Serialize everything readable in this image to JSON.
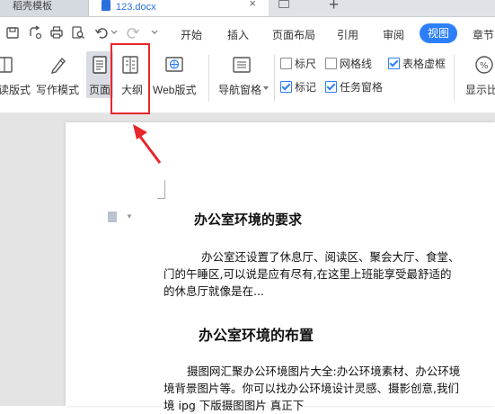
{
  "tabs": {
    "template_tab": "稻壳模板",
    "doc_tab": "123.docx",
    "close_glyph": "×",
    "new_tab_glyph": "+"
  },
  "menu": {
    "items": [
      "开始",
      "插入",
      "页面布局",
      "引用",
      "审阅"
    ],
    "active": "视图",
    "overflow": "章节"
  },
  "ribbon": {
    "views": [
      "读版式",
      "写作模式",
      "页面",
      "大纲",
      "Web版式"
    ],
    "nav_pane": "导航窗格",
    "checkboxes": [
      {
        "label": "标尺",
        "checked": false
      },
      {
        "label": "网格线",
        "checked": false
      },
      {
        "label": "表格虚框",
        "checked": true
      },
      {
        "label": "标记",
        "checked": true
      },
      {
        "label": "任务窗格",
        "checked": true
      }
    ],
    "show_ratio": "显示比"
  },
  "document": {
    "heading1": "办公室环境的要求",
    "para1": [
      "办公室还设置了休息厅、阅读区、聚会大厅、食堂、",
      "门的午睡区,可以说是应有尽有,在这里上班能享受最舒适的",
      "的休息厅就像是在..."
    ],
    "heading2": "办公室环境的布置",
    "para2": [
      "摄图网汇聚办公环境图片大全:办公环境素材、办公环境",
      "境背景图片等。你可以找办公环境设计灵感、摄影创意,我们",
      "境 ipg 下版摄图图片 真正下"
    ]
  },
  "colors": {
    "accent": "#2d7ff9",
    "highlight": "#e8262b"
  }
}
